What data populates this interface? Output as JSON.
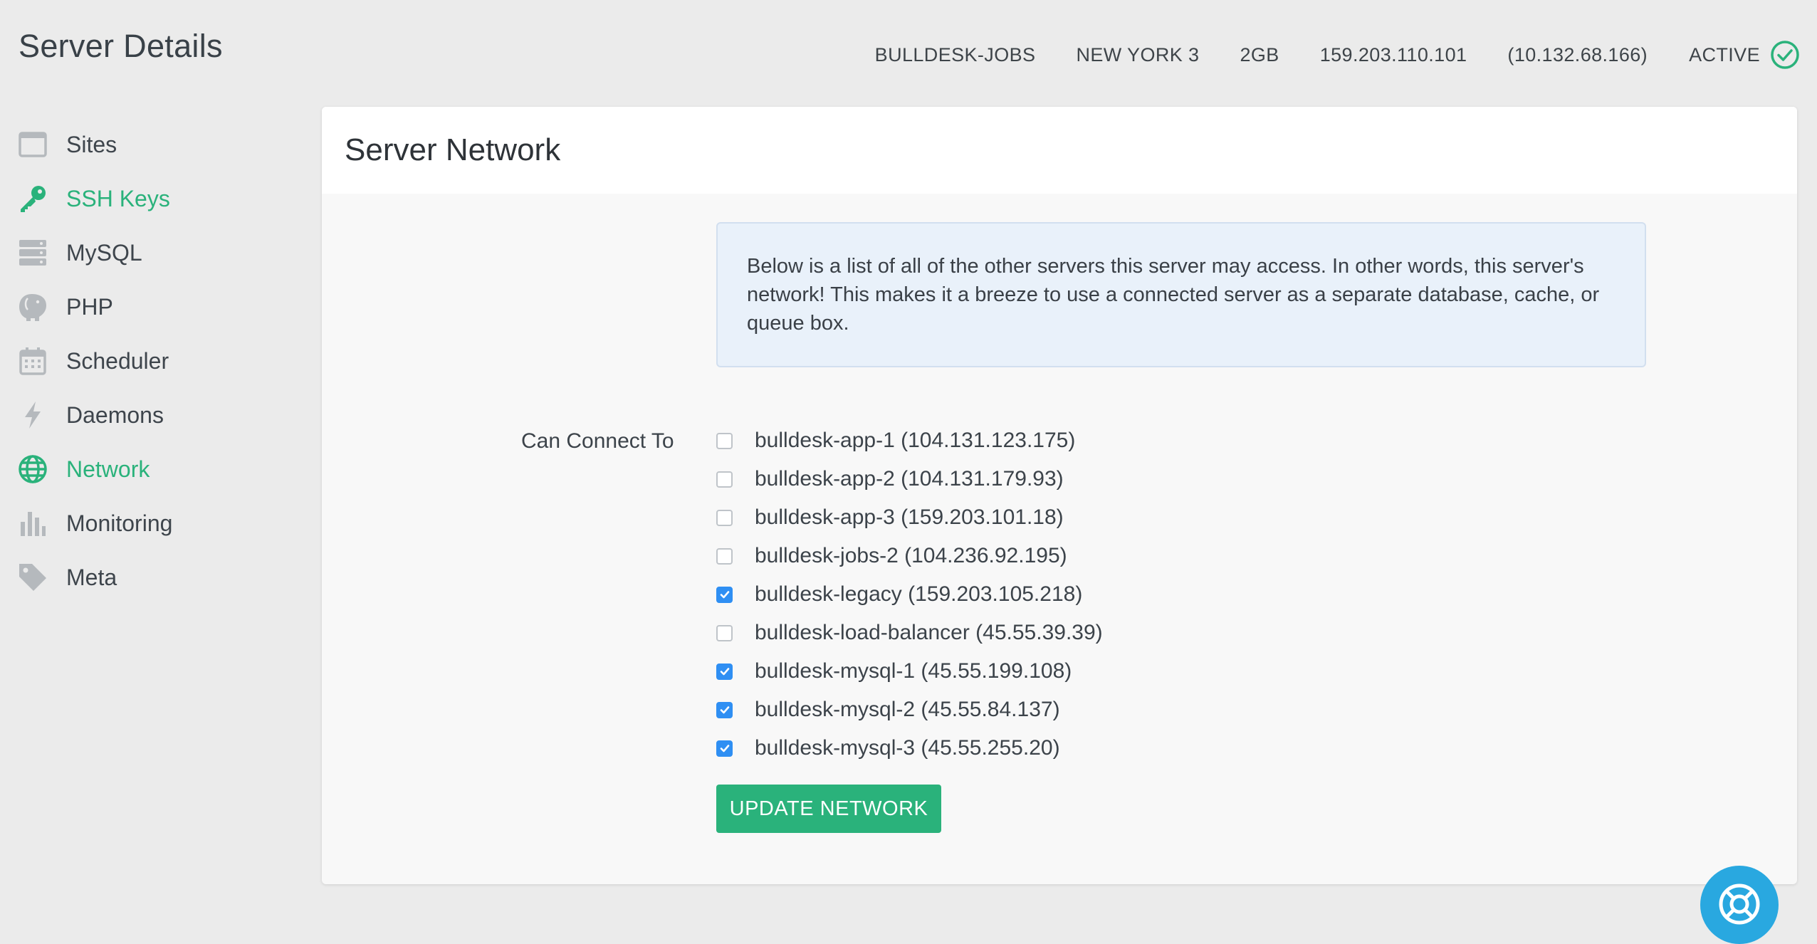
{
  "header": {
    "title": "Server Details",
    "server_name": "BULLDESK-JOBS",
    "region": "NEW YORK 3",
    "size": "2GB",
    "public_ip": "159.203.110.101",
    "private_ip": "(10.132.68.166)",
    "status": "ACTIVE",
    "status_icon": "check-circle-icon"
  },
  "sidebar": {
    "items": [
      {
        "label": "Sites",
        "icon": "browser-window-icon",
        "active": false
      },
      {
        "label": "SSH Keys",
        "icon": "key-icon",
        "active": true
      },
      {
        "label": "MySQL",
        "icon": "database-icon",
        "active": false
      },
      {
        "label": "PHP",
        "icon": "elephant-icon",
        "active": false
      },
      {
        "label": "Scheduler",
        "icon": "calendar-icon",
        "active": false
      },
      {
        "label": "Daemons",
        "icon": "bolt-icon",
        "active": false
      },
      {
        "label": "Network",
        "icon": "globe-icon",
        "active": true
      },
      {
        "label": "Monitoring",
        "icon": "bar-chart-icon",
        "active": false
      },
      {
        "label": "Meta",
        "icon": "tag-icon",
        "active": false
      }
    ]
  },
  "panel": {
    "title": "Server Network",
    "info": "Below is a list of all of the other servers this server may access. In other words, this server's network! This makes it a breeze to use a connected server as a separate database, cache, or queue box.",
    "connect_label": "Can Connect To",
    "servers": [
      {
        "label": "bulldesk-app-1 (104.131.123.175)",
        "checked": false
      },
      {
        "label": "bulldesk-app-2 (104.131.179.93)",
        "checked": false
      },
      {
        "label": "bulldesk-app-3 (159.203.101.18)",
        "checked": false
      },
      {
        "label": "bulldesk-jobs-2 (104.236.92.195)",
        "checked": false
      },
      {
        "label": "bulldesk-legacy (159.203.105.218)",
        "checked": true
      },
      {
        "label": "bulldesk-load-balancer (45.55.39.39)",
        "checked": false
      },
      {
        "label": "bulldesk-mysql-1 (45.55.199.108)",
        "checked": true
      },
      {
        "label": "bulldesk-mysql-2 (45.55.84.137)",
        "checked": true
      },
      {
        "label": "bulldesk-mysql-3 (45.55.255.20)",
        "checked": true
      }
    ],
    "update_button": "UPDATE NETWORK"
  },
  "colors": {
    "accent": "#2ab27b",
    "checkbox_checked": "#2f8ff3",
    "info_bg": "#e9f1fa",
    "help_bubble": "#29a8e0"
  },
  "help": {
    "icon": "lifebuoy-icon"
  }
}
